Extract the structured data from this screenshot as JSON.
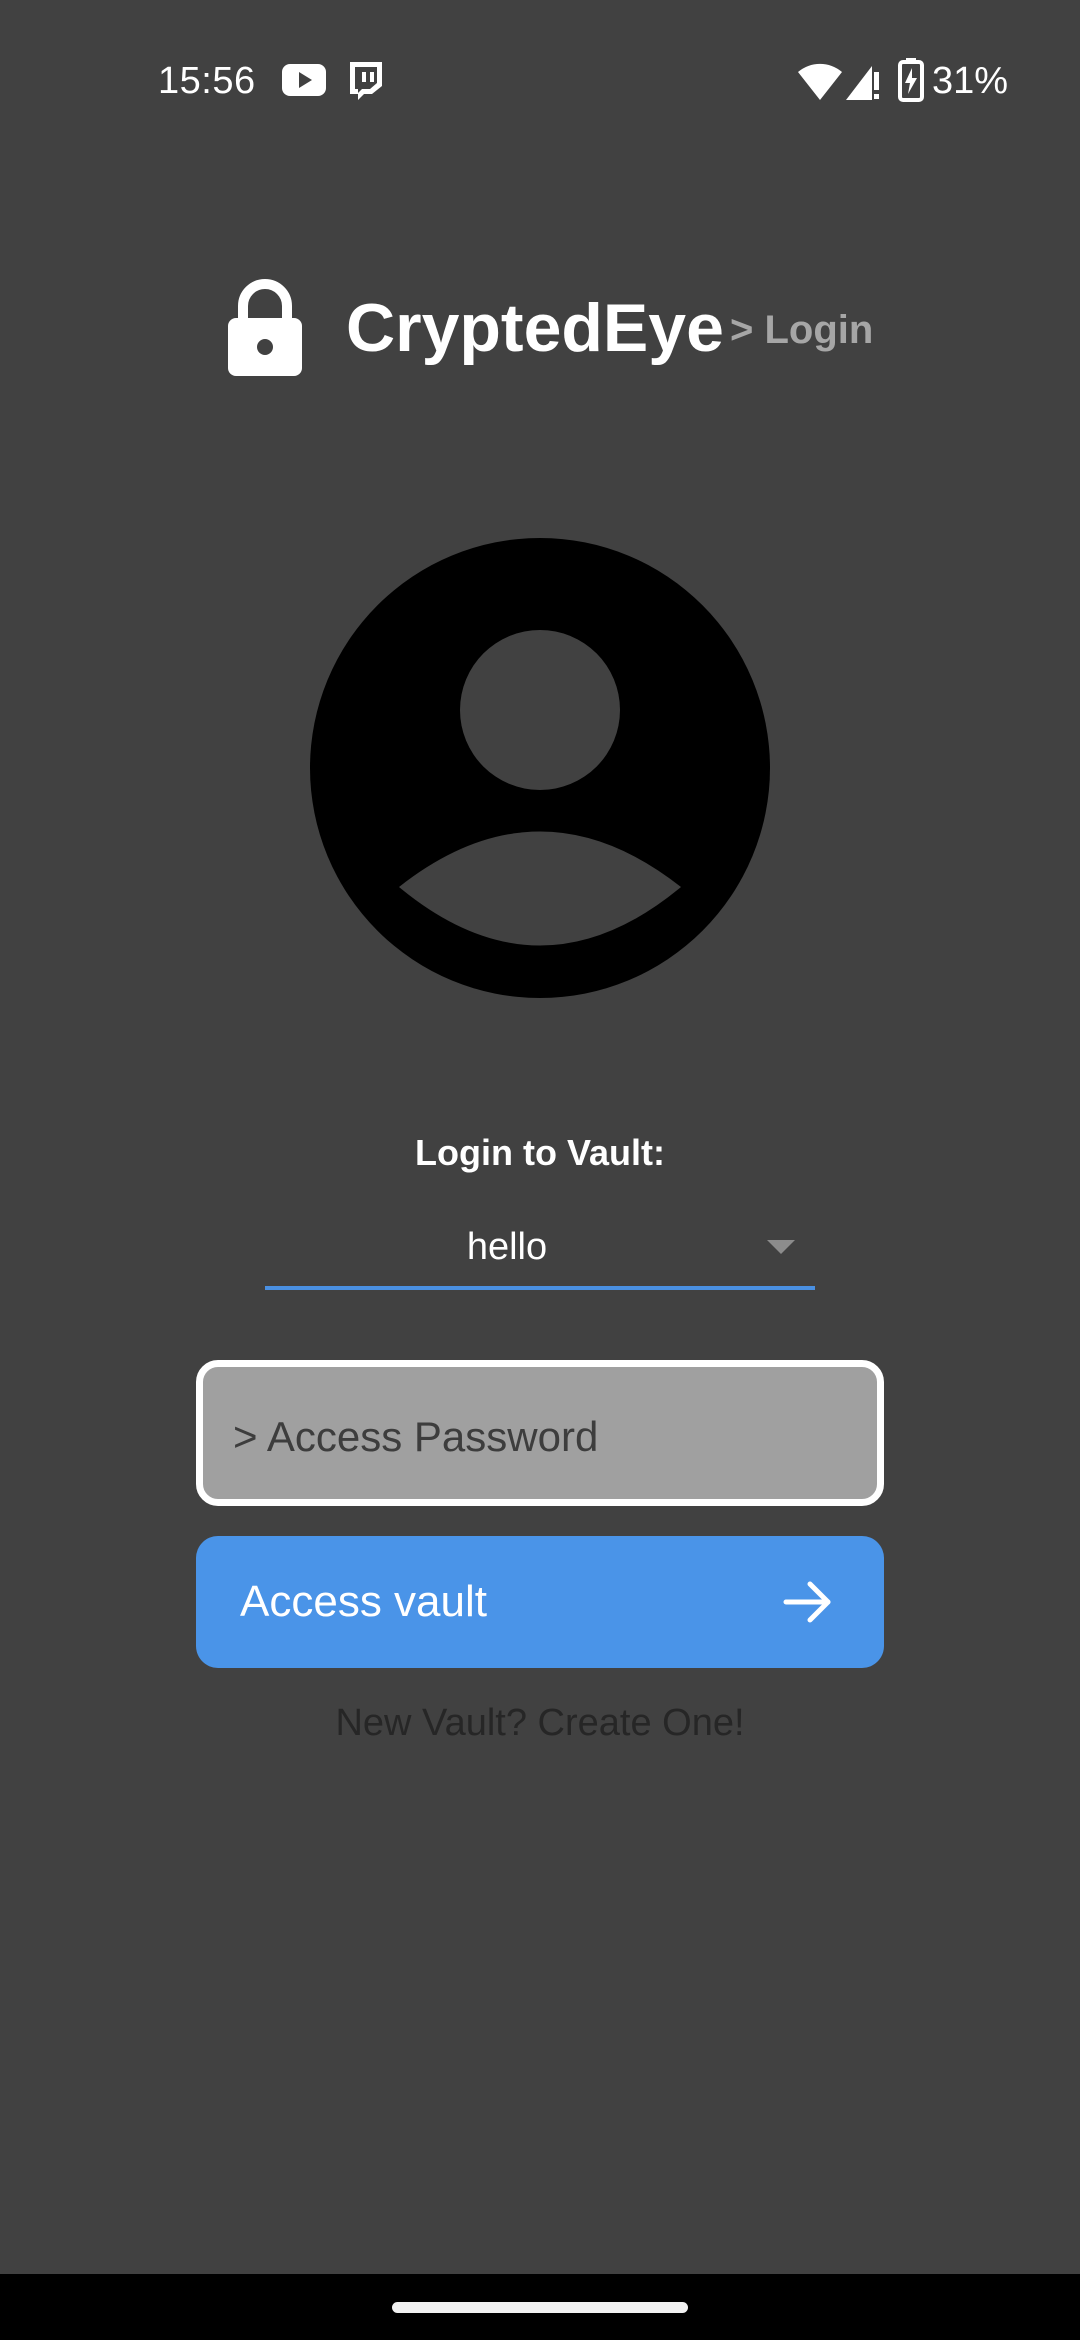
{
  "status_bar": {
    "time": "15:56",
    "battery": "31%",
    "icons": [
      "youtube-icon",
      "twitch-icon",
      "wifi-icon",
      "cell-signal-icon",
      "battery-charging-icon"
    ]
  },
  "header": {
    "icon": "lock-icon",
    "title": "CryptedEye",
    "subtitle": "> Login"
  },
  "avatar": {
    "icon": "account-circle-icon"
  },
  "login": {
    "label": "Login to Vault:",
    "selected_vault": "hello",
    "password_placeholder": "> Access Password",
    "access_button_label": "Access vault",
    "create_link": "New Vault? Create One!"
  },
  "colors": {
    "background": "#414141",
    "accent": "#4a94e8",
    "underline": "#4a90e2",
    "field_fill": "#a0a0a0",
    "subtitle": "#a6a6a6"
  }
}
